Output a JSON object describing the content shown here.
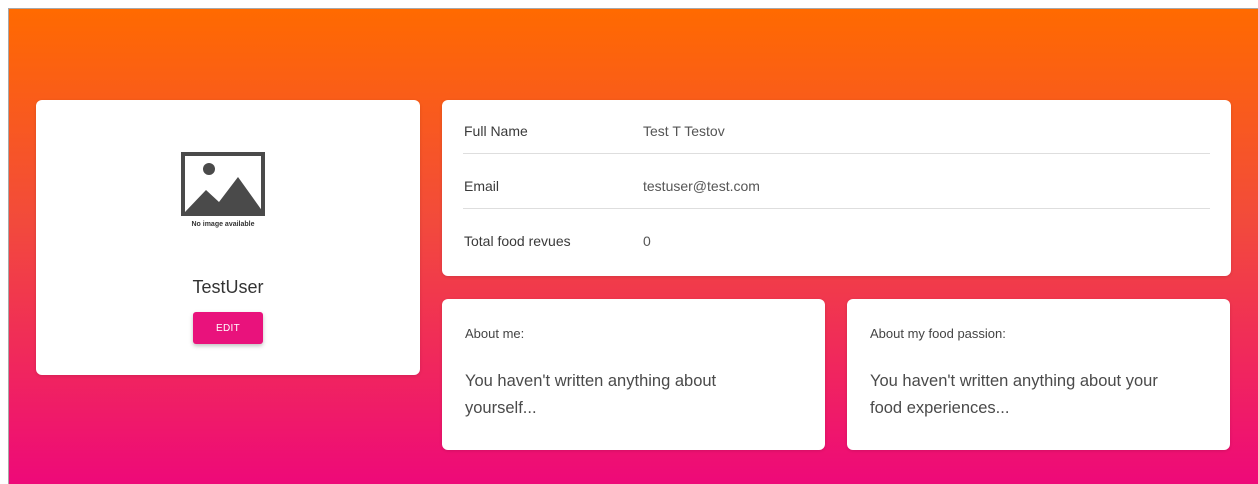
{
  "profile": {
    "image_caption": "No image available",
    "username": "TestUser",
    "edit_label": "EDIT"
  },
  "info": {
    "rows": [
      {
        "label": "Full Name",
        "value": "Test T Testov"
      },
      {
        "label": "Email",
        "value": "testuser@test.com"
      },
      {
        "label": "Total food revues",
        "value": "0"
      }
    ]
  },
  "about_me": {
    "label": "About me:",
    "text": "You haven't written anything about yourself..."
  },
  "about_food": {
    "label": "About my food passion:",
    "text": "You haven't written anything about your food experiences..."
  },
  "colors": {
    "gradient_top": "#ff6a00",
    "gradient_bottom": "#ee0979",
    "button": "#e9127c"
  }
}
